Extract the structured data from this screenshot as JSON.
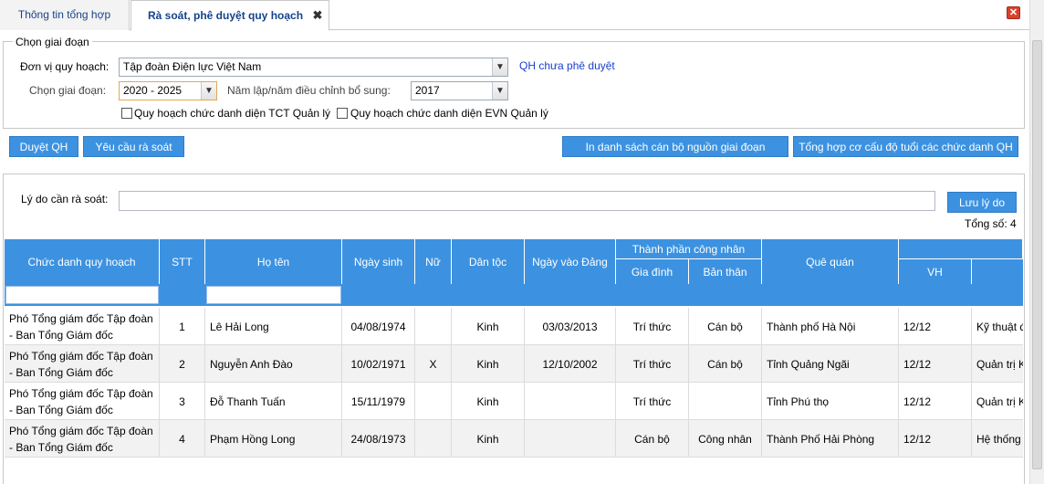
{
  "tabs": {
    "general": "Thông tin tổng hợp",
    "review": "Rà soát, phê duyệt quy hoạch"
  },
  "phase": {
    "legend": "Chọn giai đoạn",
    "unit_label": "Đơn vị quy hoạch:",
    "unit_value": "Tập đoàn Điện lực Việt Nam",
    "status_link": "QH chưa phê duyệt",
    "phase_label": "Chọn giai đoạn:",
    "phase_value": "2020 - 2025",
    "year_label": "Năm lập/năm điều chỉnh bổ sung:",
    "year_value": "2017",
    "chk_tct": "Quy hoạch chức danh diện TCT Quản lý",
    "chk_evn": "Quy hoạch chức danh diện EVN Quản lý"
  },
  "toolbar": {
    "approve": "Duyệt QH",
    "request_review": "Yêu cầu rà soát",
    "print_list": "In danh sách cán bộ nguồn giai đoạn",
    "age_summary": "Tổng hợp cơ cấu độ tuổi các chức danh QH"
  },
  "review": {
    "reason_label": "Lý do cần rà soát:",
    "save_reason": "Lưu lý do",
    "total": "Tổng số: 4"
  },
  "table": {
    "headers": {
      "position": "Chức danh quy hoạch",
      "stt": "STT",
      "name": "Họ tên",
      "dob": "Ngày sinh",
      "female": "Nữ",
      "ethnicity": "Dân tộc",
      "party_date": "Ngày vào Đảng",
      "worker_group": "Thành phần công nhân",
      "family": "Gia đình",
      "self": "Bản thân",
      "hometown": "Quê quán",
      "vh": "VH"
    },
    "rows": [
      {
        "position": "Phó Tổng giám đốc Tập đoàn - Ban Tổng Giám đốc",
        "stt": "1",
        "name": "Lê Hải Long",
        "dob": "04/08/1974",
        "female": "",
        "ethnicity": "Kinh",
        "party_date": "03/03/2013",
        "family": "Trí thức",
        "self": "Cán bộ",
        "hometown": "Thành phố Hà Nội",
        "vh": "12/12",
        "extra": "Kỹ thuật đ"
      },
      {
        "position": "Phó Tổng giám đốc Tập đoàn - Ban Tổng Giám đốc",
        "stt": "2",
        "name": "Nguyễn Anh Đào",
        "dob": "10/02/1971",
        "female": "X",
        "ethnicity": "Kinh",
        "party_date": "12/10/2002",
        "family": "Trí thức",
        "self": "Cán bộ",
        "hometown": "Tỉnh Quảng Ngãi",
        "vh": "12/12",
        "extra": "Quản trị K"
      },
      {
        "position": "Phó Tổng giám đốc Tập đoàn - Ban Tổng Giám đốc",
        "stt": "3",
        "name": "Đỗ Thanh Tuấn",
        "dob": "15/11/1979",
        "female": "",
        "ethnicity": "Kinh",
        "party_date": "",
        "family": "Trí thức",
        "self": "",
        "hometown": "Tỉnh Phú thọ",
        "vh": "12/12",
        "extra": "Quản trị K"
      },
      {
        "position": "Phó Tổng giám đốc Tập đoàn - Ban Tổng Giám đốc",
        "stt": "4",
        "name": "Phạm Hồng Long",
        "dob": "24/08/1973",
        "female": "",
        "ethnicity": "Kinh",
        "party_date": "",
        "family": "Cán bộ",
        "self": "Công nhân",
        "hometown": "Thành Phố Hải Phòng",
        "vh": "12/12",
        "extra": "Hệ thống"
      }
    ]
  },
  "colors": {
    "accent": "#3c92e0",
    "tab_text": "#15428b",
    "link": "#1a3ecf"
  }
}
